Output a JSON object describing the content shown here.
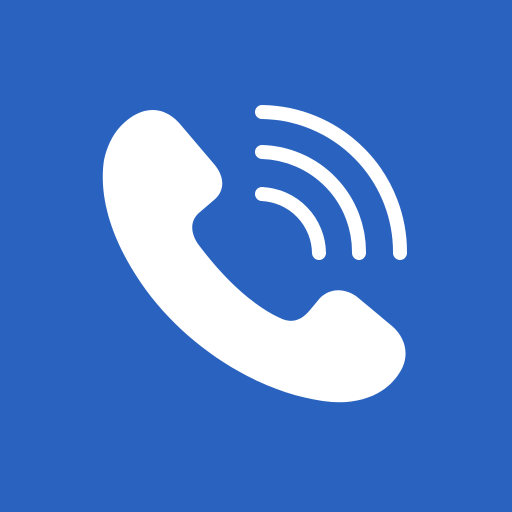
{
  "app_icon": {
    "icon": "phone-call-icon",
    "background_color": "#2a63bf",
    "glyph_color": "#ffffff"
  }
}
